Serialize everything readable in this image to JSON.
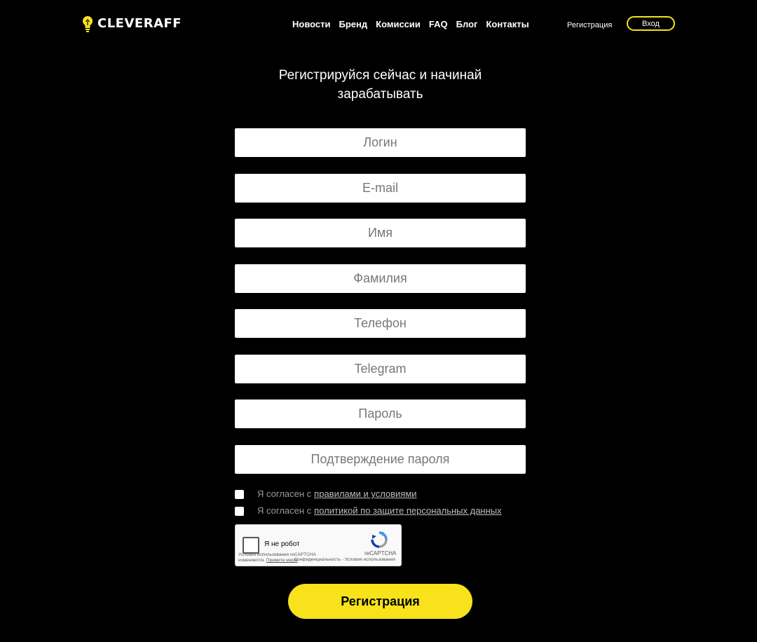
{
  "header": {
    "logo_text": "CLEVERAFF",
    "nav": [
      "Новости",
      "Бренд",
      "Комиссии",
      "FAQ",
      "Блог",
      "Контакты"
    ],
    "register_link": "Регистрация",
    "login_button": "Вход",
    "accent_color": "#f7e21b"
  },
  "main": {
    "title": "Регистрируйся сейчас и начинай зарабатывать",
    "fields": {
      "login": {
        "placeholder": "Логин",
        "value": ""
      },
      "email": {
        "placeholder": "E-mail",
        "value": ""
      },
      "first_name": {
        "placeholder": "Имя",
        "value": ""
      },
      "last_name": {
        "placeholder": "Фамилия",
        "value": ""
      },
      "phone": {
        "placeholder": "Телефон",
        "value": ""
      },
      "telegram": {
        "placeholder": "Telegram",
        "value": ""
      },
      "password": {
        "placeholder": "Пароль",
        "value": ""
      },
      "password_confirm": {
        "placeholder": "Подтверждение пароля",
        "value": ""
      }
    },
    "agree_terms": {
      "prefix": "Я согласен с",
      "link": "правилами и условиями",
      "checked": false
    },
    "agree_privacy": {
      "prefix": "Я согласен с",
      "link": "политикой по защите персональных данных",
      "checked": false
    },
    "captcha": {
      "label": "Я не робот",
      "brand": "reCAPTCHA",
      "terms_prefix": "Условия использования reCAPTCHA изменяются.",
      "terms_link": "Примите меры",
      "privacy": "Конфиденциальность - Условия использования"
    },
    "submit_label": "Регистрация"
  },
  "icons": {
    "logo": "lightbulb-icon",
    "captcha": "recaptcha-icon"
  }
}
